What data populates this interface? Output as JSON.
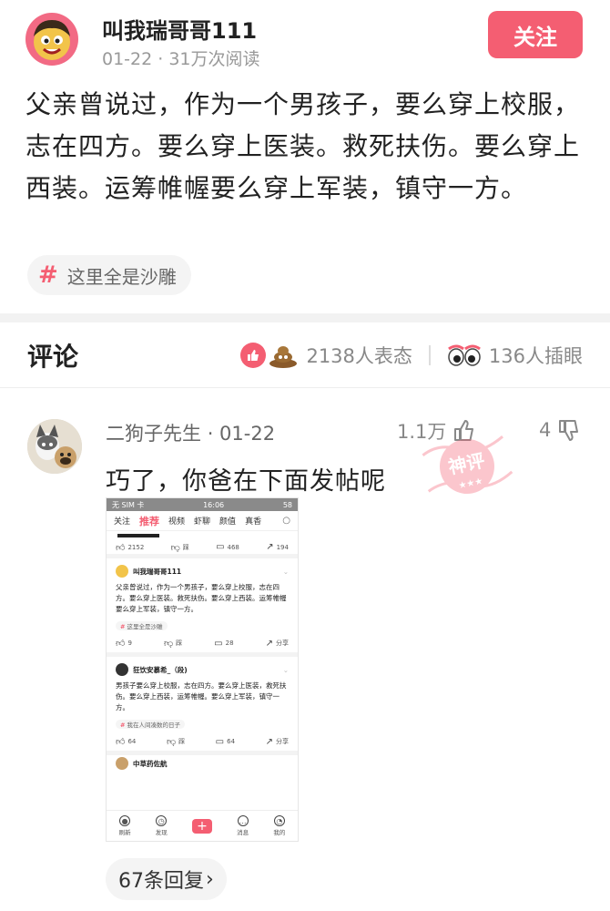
{
  "post": {
    "author": "叫我瑞哥哥111",
    "meta": "01-22 · 31万次阅读",
    "follow_label": "关注",
    "body": "父亲曾说过，作为一个男孩子，要么穿上校服，志在四方。要么穿上医装。救死扶伤。要么穿上西装。运筹帷幄要么穿上军装，镇守一方。",
    "topic": "这里全是沙雕"
  },
  "comments_header": {
    "title": "评论",
    "reactions_text": "2138人表态",
    "inserts_text": "136人插眼"
  },
  "comment": {
    "author": "二狗子先生",
    "date": "01-22",
    "likes": "1.1万",
    "dislikes": "4",
    "text": "巧了，你爸在下面发帖呢",
    "stamp": "神评",
    "replies_label": "67条回复"
  },
  "screenshot": {
    "status_left": "无 SIM 卡",
    "status_time": "16:06",
    "status_right": "58",
    "nav": [
      "关注",
      "推荐",
      "视频",
      "虾聊",
      "颜值",
      "真香"
    ],
    "top_actions": {
      "like": "2152",
      "dislike": "踩",
      "comment": "468",
      "share": "194"
    },
    "post1": {
      "author": "叫我瑞哥哥111",
      "text": "父亲曾说过，作为一个男孩子，要么穿上校服，志在四方。要么穿上医装。救死扶伤。要么穿上西装。运筹帷幄要么穿上军装，镇守一方。",
      "tag": "这里全是沙雕",
      "like": "9",
      "dislike": "踩",
      "comment": "28",
      "share": "分享"
    },
    "post2": {
      "author": "狂饮安慕希_（段)",
      "text": "男孩子要么穿上校服，志在四方。要么穿上医装，救死扶伤。要么穿上西装，运筹帷幄。要么穿上军装，镇守一方。",
      "tag": "我在人间凑数的日子",
      "like": "64",
      "dislike": "踩",
      "comment": "64",
      "share": "分享"
    },
    "post3_author": "中草药佐航",
    "tabbar": [
      "刷新",
      "发现",
      "",
      "消息",
      "我的"
    ]
  },
  "colors": {
    "accent": "#f45e72",
    "muted": "#999999"
  }
}
